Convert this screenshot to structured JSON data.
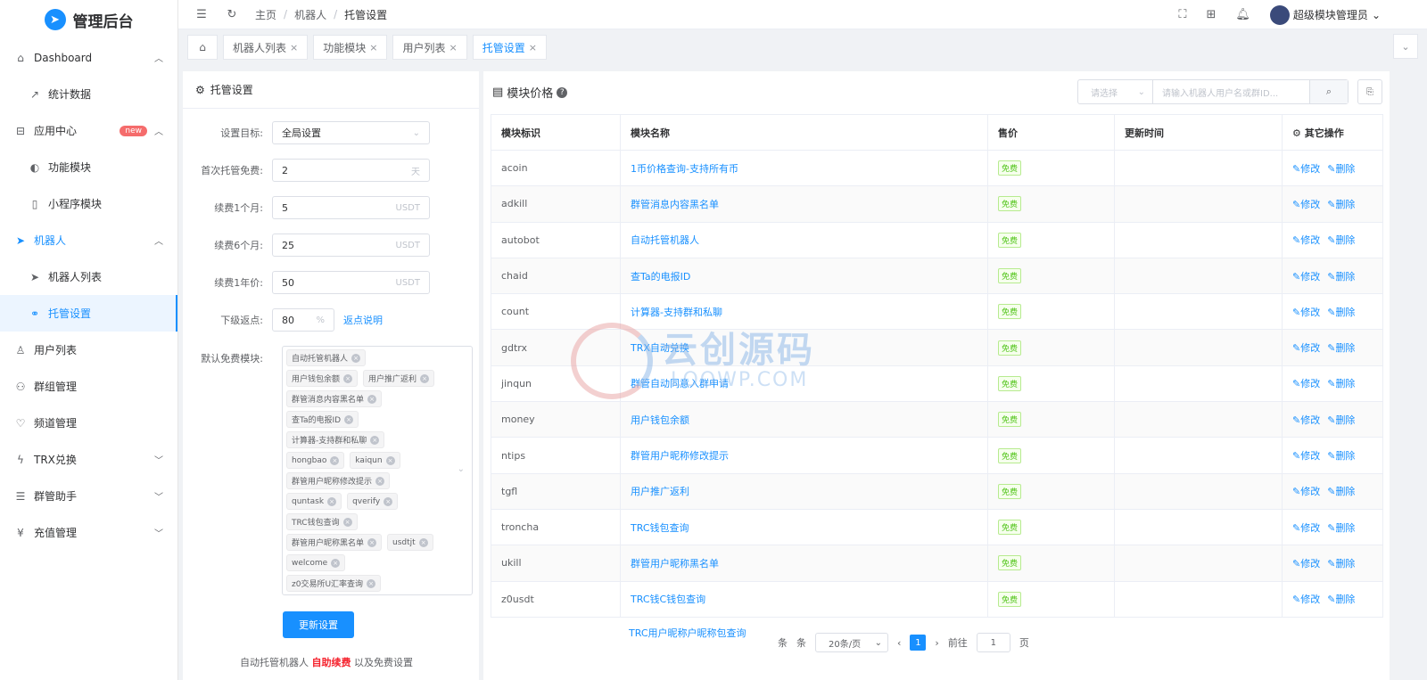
{
  "app": {
    "title": "管理后台"
  },
  "sidebar": {
    "items": [
      {
        "label": "Dashboard",
        "icon": "home-icon"
      },
      {
        "label": "统计数据",
        "icon": "trend-icon"
      },
      {
        "label": "应用中心",
        "icon": "app-icon",
        "badge": "new"
      },
      {
        "label": "功能模块",
        "icon": "toggle-icon"
      },
      {
        "label": "小程序模块",
        "icon": "phone-icon"
      },
      {
        "label": "机器人",
        "icon": "telegram-icon"
      },
      {
        "label": "机器人列表",
        "icon": "telegram-icon"
      },
      {
        "label": "托管设置",
        "icon": "link-icon"
      },
      {
        "label": "用户列表",
        "icon": "user-icon"
      },
      {
        "label": "群组管理",
        "icon": "group-icon"
      },
      {
        "label": "频道管理",
        "icon": "heart-icon"
      },
      {
        "label": "TRX兑换",
        "icon": "bolt-icon"
      },
      {
        "label": "群管助手",
        "icon": "list-icon"
      },
      {
        "label": "充值管理",
        "icon": "yen-icon"
      }
    ]
  },
  "topbar": {
    "breadcrumb": [
      "主页",
      "机器人",
      "托管设置"
    ],
    "user": "超级模块管理员"
  },
  "tabs": [
    {
      "label": "机器人列表"
    },
    {
      "label": "功能模块"
    },
    {
      "label": "用户列表"
    },
    {
      "label": "托管设置"
    }
  ],
  "settings": {
    "title": "托管设置",
    "target_label": "设置目标:",
    "target_value": "全局设置",
    "free_label": "首次托管免费:",
    "free_value": "2",
    "free_suffix": "天",
    "m1_label": "续费1个月:",
    "m1_value": "5",
    "m6_label": "续费6个月:",
    "m6_value": "25",
    "y1_label": "续费1年价:",
    "y1_value": "50",
    "usdt": "USDT",
    "rebate_label": "下级返点:",
    "rebate_value": "80",
    "percent": "%",
    "rebate_link": "返点说明",
    "modules_label": "默认免费模块:",
    "tags": [
      [
        "自动托管机器人"
      ],
      [
        "用户钱包余额",
        "用户推广返利"
      ],
      [
        "群管消息内容黑名单"
      ],
      [
        "查Ta的电报ID"
      ],
      [
        "计算器-支持群和私聊"
      ],
      [
        "hongbao",
        "kaiqun"
      ],
      [
        "群管用户昵称修改提示"
      ],
      [
        "quntask",
        "qverify"
      ],
      [
        "TRC钱包查询"
      ],
      [
        "群管用户昵称黑名单",
        "usdtjt"
      ],
      [
        "welcome"
      ],
      [
        "z0交易所U汇率查询"
      ]
    ],
    "submit": "更新设置",
    "note_a": "自动托管机器人",
    "note_b": "自助续费",
    "note_c": "以及免费设置"
  },
  "prices": {
    "title": "模块价格",
    "select_placeholder": "请选择",
    "search_placeholder": "请输入机器人用户名或群ID...",
    "headers": [
      "模块标识",
      "模块名称",
      "售价",
      "更新时间",
      "其它操作"
    ],
    "free": "免费",
    "edit": "修改",
    "delete": "删除",
    "rows": [
      {
        "id": "acoin",
        "name": "1币价格查询-支持所有币"
      },
      {
        "id": "adkill",
        "name": "群管消息内容黑名单"
      },
      {
        "id": "autobot",
        "name": "自动托管机器人"
      },
      {
        "id": "chaid",
        "name": "查Ta的电报ID"
      },
      {
        "id": "count",
        "name": "计算器-支持群和私聊"
      },
      {
        "id": "gdtrx",
        "name": "TRX自动兑换"
      },
      {
        "id": "jinqun",
        "name": "群管自动同意入群申请"
      },
      {
        "id": "money",
        "name": "用户钱包余额"
      },
      {
        "id": "ntips",
        "name": "群管用户昵称修改提示"
      },
      {
        "id": "tgfl",
        "name": "用户推广返利"
      },
      {
        "id": "troncha",
        "name": "TRC钱包查询"
      },
      {
        "id": "ukill",
        "name": "群管用户昵称黑名单"
      },
      {
        "id": "z0usdt",
        "name": "TRC钱C钱包查询"
      }
    ],
    "leak_text": "TRC用户昵称户昵称包查询",
    "pager": {
      "tiao1": "条",
      "tiao2": "条",
      "page_size": "20条/页",
      "current": "1",
      "goto": "前往",
      "goto_value": "1",
      "ye": "页"
    }
  },
  "watermark": {
    "zh": "云创源码",
    "en": "LOOWP.COM"
  }
}
